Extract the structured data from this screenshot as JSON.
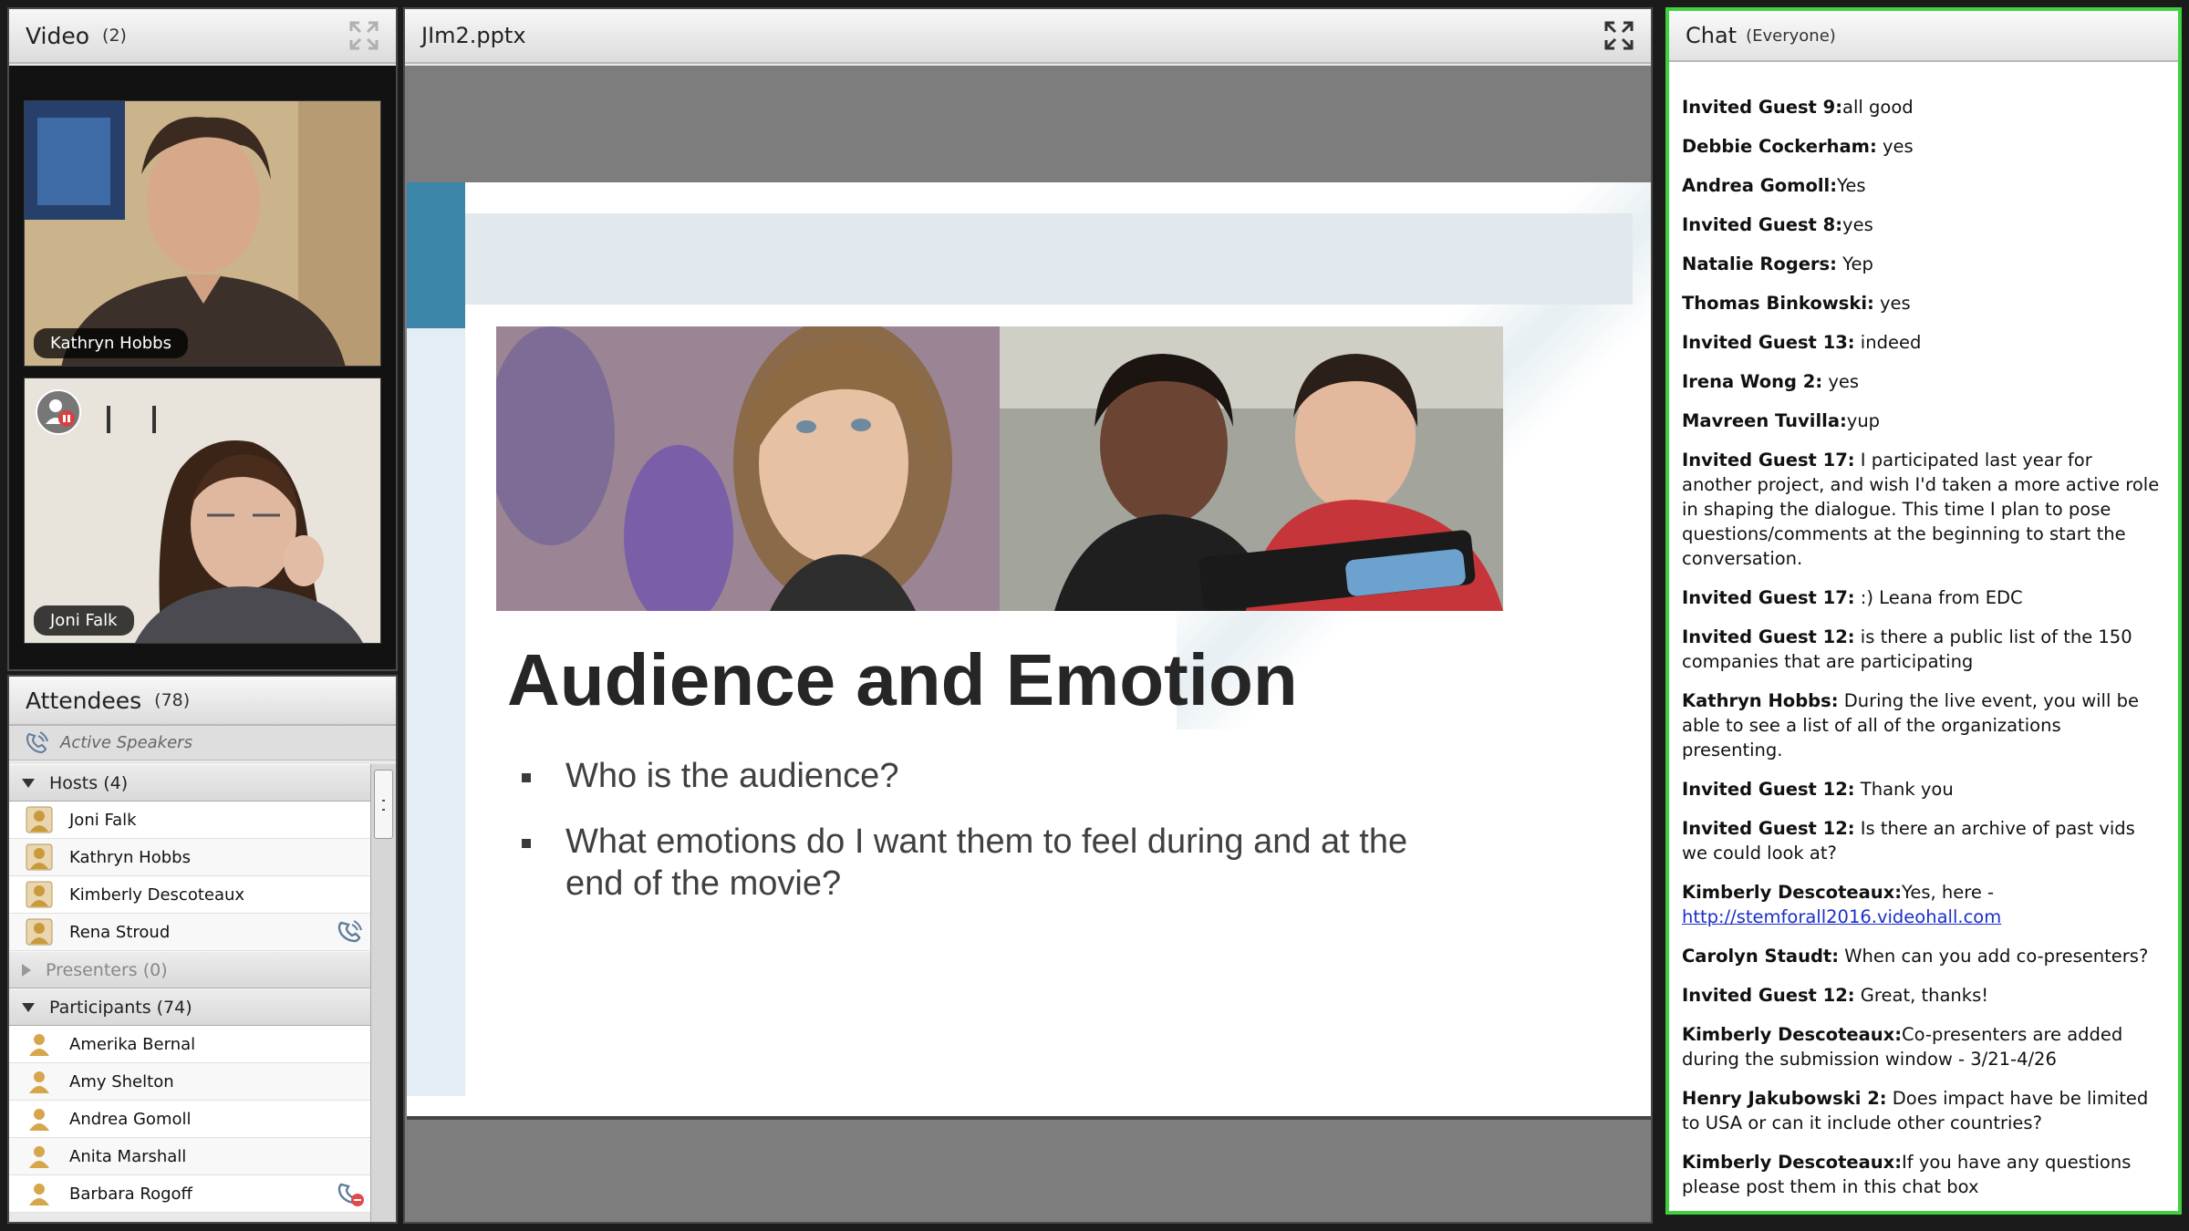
{
  "video": {
    "title": "Video",
    "count": "(2)",
    "tiles": [
      {
        "name": "Kathryn Hobbs"
      },
      {
        "name": "Joni Falk"
      }
    ]
  },
  "attendees": {
    "title": "Attendees",
    "count": "(78)",
    "active_speakers": "Active Speakers",
    "hosts": {
      "label": "Hosts (4)",
      "people": [
        "Joni Falk",
        "Kathryn Hobbs",
        "Kimberly Descoteaux",
        "Rena Stroud"
      ]
    },
    "presenters": {
      "label": "Presenters (0)"
    },
    "participants": {
      "label": "Participants (74)",
      "people": [
        "Amerika Bernal",
        "Amy Shelton",
        "Andrea  Gomoll",
        "Anita Marshall",
        "Barbara Rogoff"
      ]
    }
  },
  "share": {
    "title": "JIm2.pptx",
    "slide": {
      "title": "Audience and Emotion",
      "bullets": [
        "Who is the audience?",
        "What emotions do I want them to feel during and at the end of the movie?"
      ]
    }
  },
  "chat": {
    "title": "Chat",
    "scope": "(Everyone)",
    "messages": [
      {
        "sender": "Invited Guest 9:",
        "text": "all good"
      },
      {
        "sender": "Debbie Cockerham:",
        "text": " yes"
      },
      {
        "sender": "Andrea  Gomoll:",
        "text": "Yes"
      },
      {
        "sender": "Invited Guest 8:",
        "text": "yes"
      },
      {
        "sender": "Natalie Rogers:",
        "text": "  Yep"
      },
      {
        "sender": "Thomas Binkowski:",
        "text": " yes"
      },
      {
        "sender": "Invited Guest 13:",
        "text": " indeed"
      },
      {
        "sender": "Irena Wong 2:",
        "text": " yes"
      },
      {
        "sender": "Mavreen Tuvilla:",
        "text": "yup"
      },
      {
        "sender": "Invited Guest 17:",
        "text": " I participated last year for another project, and wish I'd taken a more active role in shaping the dialogue. This time I plan to pose questions/comments at the beginning to start the conversation."
      },
      {
        "sender": "Invited Guest 17:",
        "text": " :) Leana from EDC"
      },
      {
        "sender": "Invited Guest 12:",
        "text": " is there a public list of the 150 companies that are participating"
      },
      {
        "sender": "Kathryn Hobbs:",
        "text": "  During the live event, you will be able to see a list of all of the organizations presenting."
      },
      {
        "sender": "Invited Guest 12:",
        "text": " Thank you"
      },
      {
        "sender": "Invited Guest 12:",
        "text": " Is there an archive of past vids we could look at?"
      },
      {
        "sender": "Kimberly Descoteaux:",
        "text": "Yes, here - ",
        "link": "http://stemforall2016.videohall.com "
      },
      {
        "sender": "Carolyn Staudt:",
        "text": "  When can you add co-presenters?"
      },
      {
        "sender": "Invited Guest 12:",
        "text": " Great, thanks!"
      },
      {
        "sender": "Kimberly Descoteaux:",
        "text": "Co-presenters are added during the submission window - 3/21-4/26"
      },
      {
        "sender": "Henry Jakubowski 2:",
        "text": " Does impact have be limited to USA or can it include other countries?"
      },
      {
        "sender": "Kimberly Descoteaux:",
        "text": "If you have any questions please post them in this chat box"
      }
    ]
  },
  "colors": {
    "chat_focus_border": "#3fd13f",
    "slide_accent": "#3a85a8",
    "link": "#1a2fc9"
  }
}
